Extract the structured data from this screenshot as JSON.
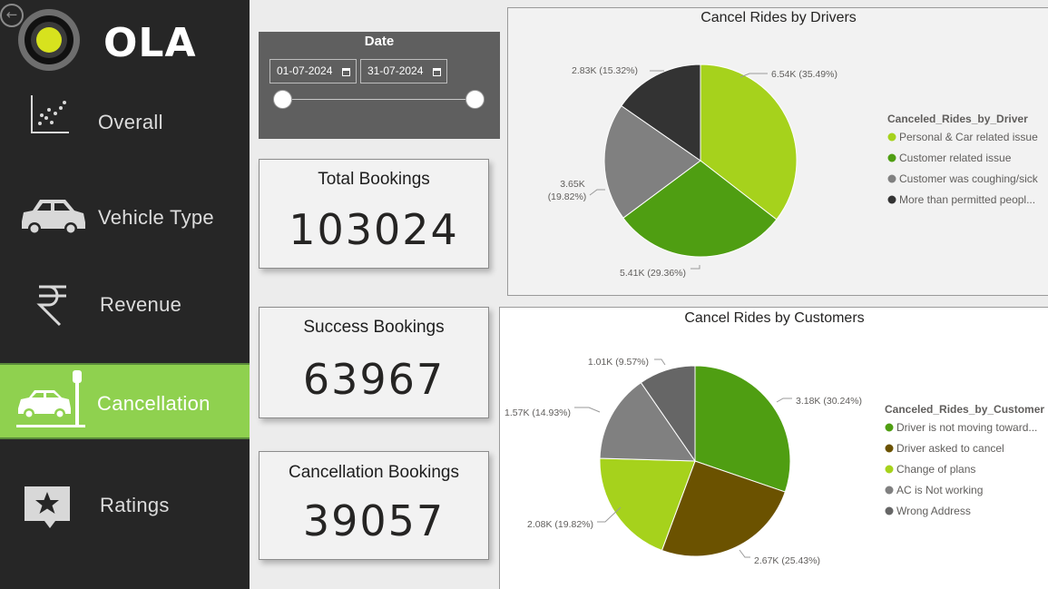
{
  "nav": {
    "logo_text": "OLA",
    "items": [
      {
        "label": "Overall"
      },
      {
        "label": "Vehicle Type"
      },
      {
        "label": "Revenue"
      },
      {
        "label": "Cancellation"
      },
      {
        "label": "Ratings"
      }
    ],
    "active": "Cancellation"
  },
  "date_filter": {
    "title": "Date",
    "start": "01-07-2024",
    "end": "31-07-2024"
  },
  "kpis": {
    "total": {
      "label": "Total Bookings",
      "value": "103024"
    },
    "success": {
      "label": "Success Bookings",
      "value": "63967"
    },
    "cancel": {
      "label": "Cancellation Bookings",
      "value": "39057"
    }
  },
  "colors": {
    "sidebar": "#262626",
    "active_nav": "#8fd14f",
    "date_panel": "#5f5f5f"
  },
  "chart_data": [
    {
      "type": "pie",
      "title": "Cancel Rides by Drivers",
      "legend_title": "Canceled_Rides_by_Driver",
      "legend_position": "right",
      "slices": [
        {
          "label": "Personal & Car related issue",
          "value": 6540,
          "data_label": "6.54K (35.49%)",
          "color": "#a6d21c"
        },
        {
          "label": "Customer related issue",
          "value": 5410,
          "data_label": "5.41K (29.36%)",
          "color": "#4f9e12"
        },
        {
          "label": "Customer was coughing/sick",
          "value": 3650,
          "data_label": "3.65K (19.82%)",
          "color": "#808080"
        },
        {
          "label": "More than permitted peopl...",
          "value": 2830,
          "data_label": "2.83K (15.32%)",
          "color": "#333333"
        }
      ]
    },
    {
      "type": "pie",
      "title": "Cancel Rides by Customers",
      "legend_title": "Canceled_Rides_by_Customer",
      "legend_position": "right",
      "slices": [
        {
          "label": "Driver is not moving toward...",
          "value": 3180,
          "data_label": "3.18K (30.24%)",
          "color": "#4f9e12"
        },
        {
          "label": "Driver asked to cancel",
          "value": 2670,
          "data_label": "2.67K (25.43%)",
          "color": "#6b5200"
        },
        {
          "label": "Change of plans",
          "value": 2080,
          "data_label": "2.08K (19.82%)",
          "color": "#a6d21c"
        },
        {
          "label": "AC is Not working",
          "value": 1570,
          "data_label": "1.57K (14.93%)",
          "color": "#808080"
        },
        {
          "label": "Wrong Address",
          "value": 1010,
          "data_label": "1.01K (9.57%)",
          "color": "#666666"
        }
      ]
    }
  ]
}
